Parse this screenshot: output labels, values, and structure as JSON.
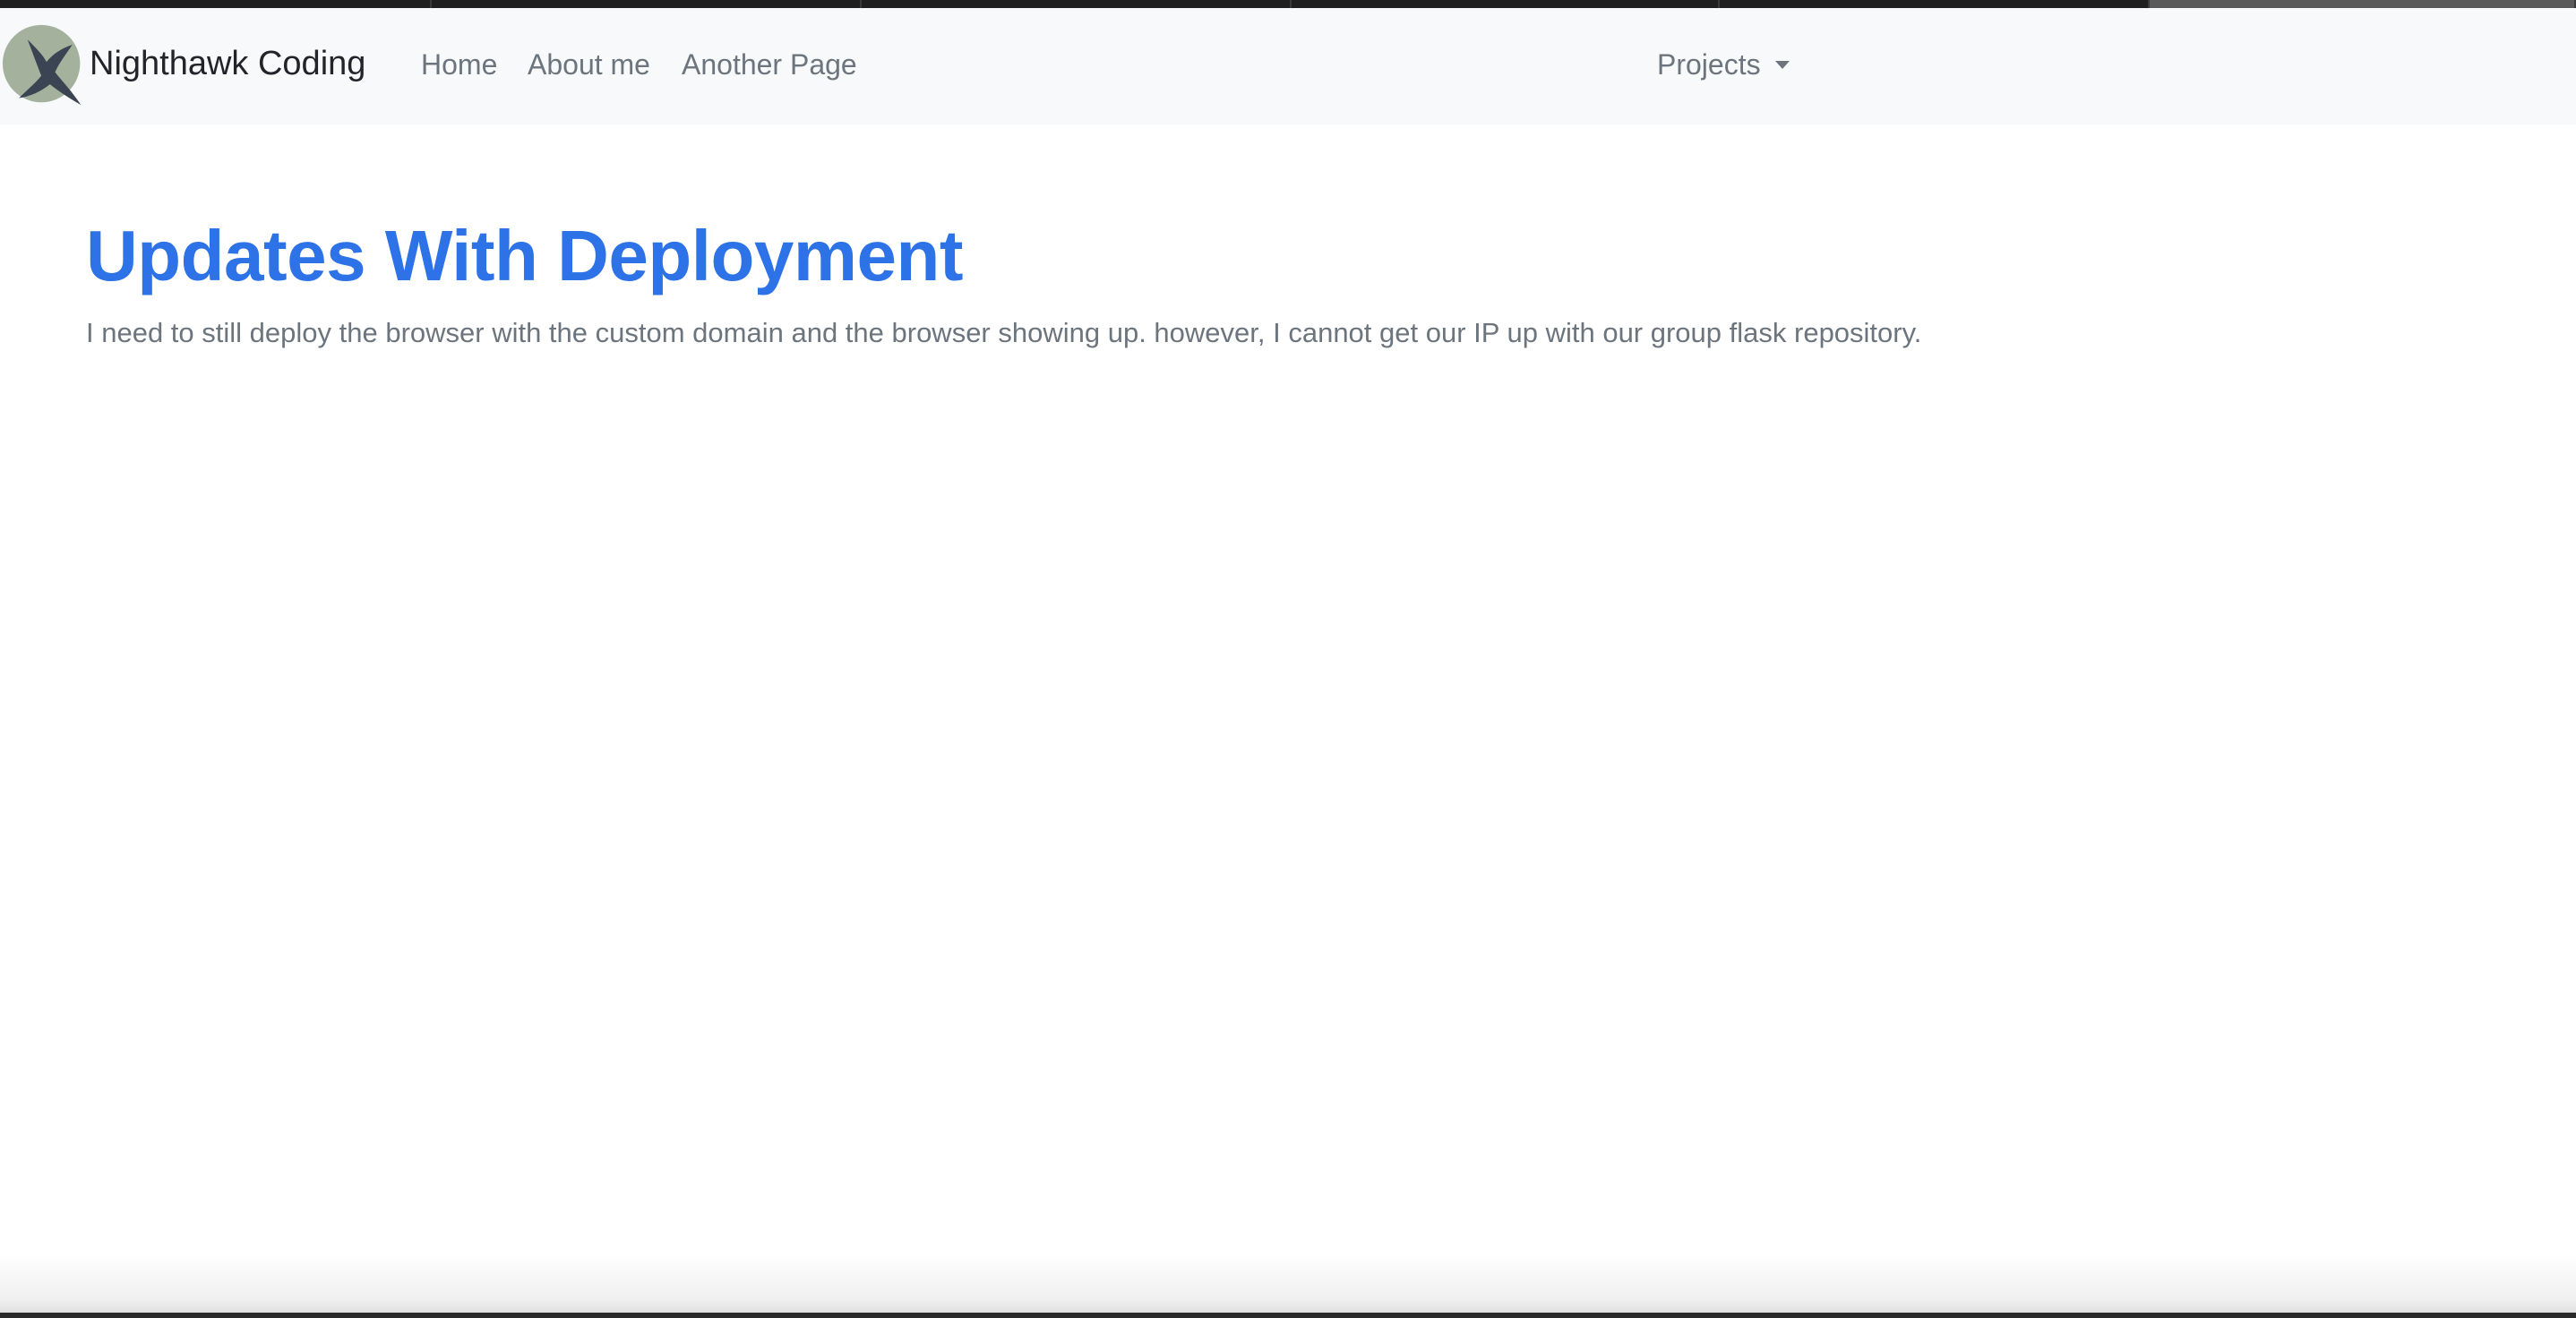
{
  "navbar": {
    "brand": "Nighthawk Coding",
    "logo_icon": "hawk-logo-icon",
    "links": [
      {
        "label": "Home"
      },
      {
        "label": "About me"
      },
      {
        "label": "Another Page"
      }
    ],
    "dropdown": {
      "label": "Projects",
      "icon": "caret-down-icon"
    }
  },
  "main": {
    "title": "Updates With Deployment",
    "body": "I need to still deploy the browser with the custom domain and the browser showing up. however, I cannot get our IP up with our group flask repository."
  },
  "colors": {
    "accent": "#2d72e6",
    "navbar_bg": "#f8f9fa",
    "muted_text": "#6c757d",
    "brand_text": "#212529"
  }
}
